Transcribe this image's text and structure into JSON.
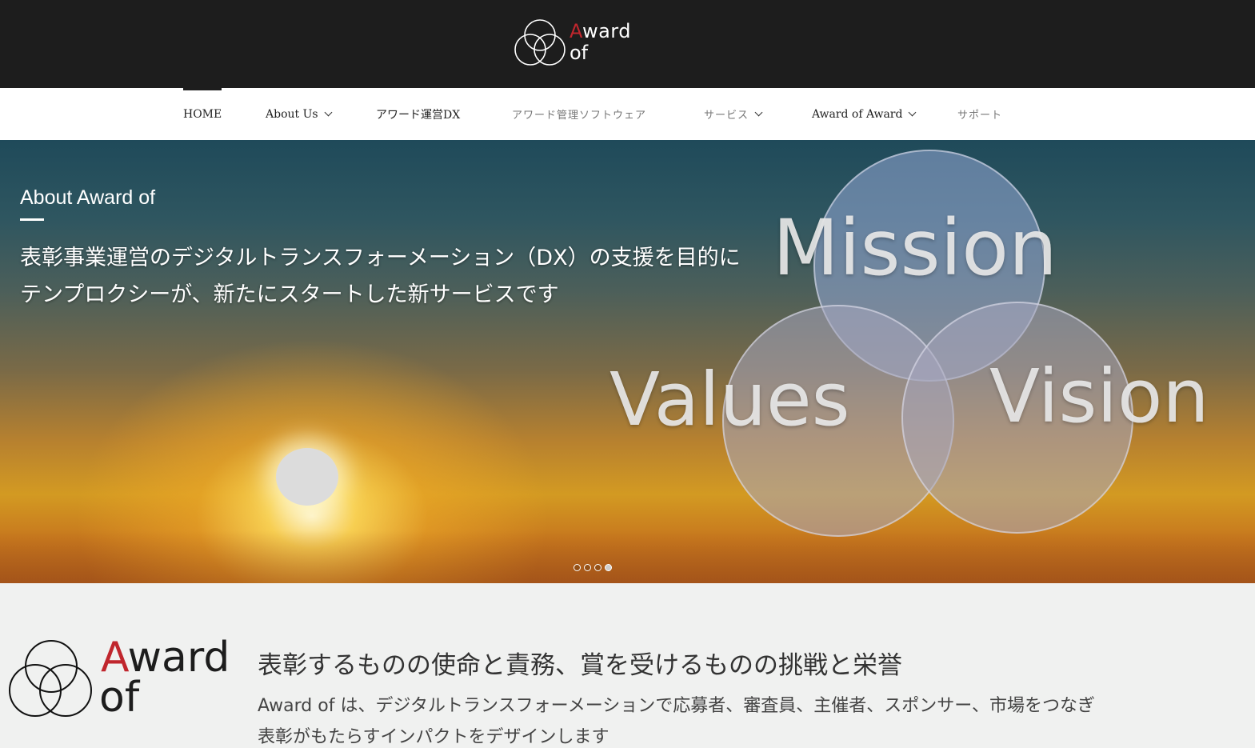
{
  "header": {
    "logo_a": "A",
    "logo_ward": "ward",
    "logo_of": "of",
    "logo_icon": "interlocking-circles-icon"
  },
  "nav": {
    "items": [
      {
        "label": "HOME",
        "has_dropdown": false,
        "active": true
      },
      {
        "label": "About Us",
        "has_dropdown": true
      },
      {
        "label": "アワード運営DX",
        "has_dropdown": false
      },
      {
        "label": "アワード管理ソフトウェア",
        "has_dropdown": false
      },
      {
        "label": "サービス",
        "has_dropdown": true
      },
      {
        "label": "Award of Award",
        "has_dropdown": true
      },
      {
        "label": "サポート",
        "has_dropdown": false
      }
    ]
  },
  "hero": {
    "kicker": "About Award of",
    "line1": "表彰事業運営のデジタルトランスフォーメーション（DX）の支援を目的に",
    "line2": "テンプロクシーが、新たにスタートした新サービスです",
    "venn": {
      "mission": "Mission",
      "values": "Values",
      "vision": "Vision"
    },
    "slides_total": 4,
    "active_slide": 4
  },
  "intro": {
    "logo_a": "A",
    "logo_ward": "ward",
    "logo_of": "of",
    "heading": "表彰するものの使命と責務、賞を受けるものの挑戦と栄誉",
    "body": "Award of は、デジタルトランスフォーメーションで応募者、審査員、主催者、スポンサー、市場をつなぎ",
    "body2": "表彰がもたらすインパクトをデザインします"
  },
  "colors": {
    "header_bg": "#1d1d1d",
    "brand_red": "#c0262d",
    "nav_bg": "#ffffff",
    "section_bg": "#f0f1f0"
  }
}
